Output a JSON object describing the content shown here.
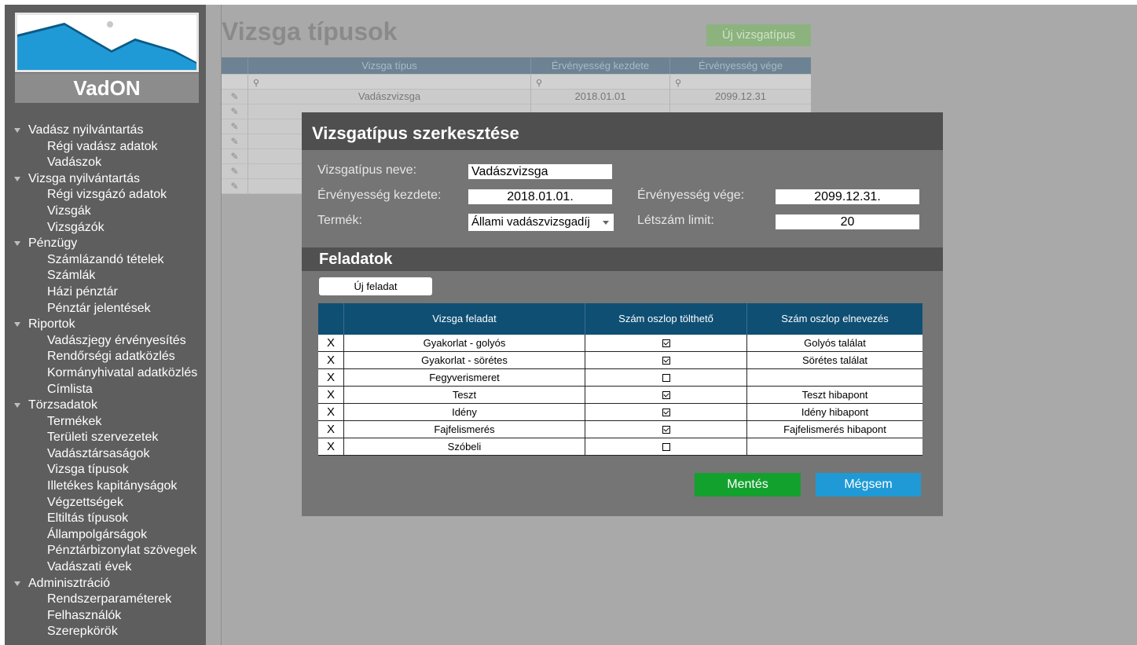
{
  "brand": "VadON",
  "menu": [
    {
      "title": "Vadász nyilvántartás",
      "items": [
        "Régi vadász adatok",
        "Vadászok"
      ]
    },
    {
      "title": "Vizsga nyilvántartás",
      "items": [
        "Régi vizsgázó adatok",
        "Vizsgák",
        "Vizsgázók"
      ]
    },
    {
      "title": "Pénzügy",
      "items": [
        "Számlázandó tételek",
        "Számlák",
        "Házi pénztár",
        "Pénztár jelentések"
      ]
    },
    {
      "title": "Riportok",
      "items": [
        "Vadászjegy érvényesítés",
        "Rendőrségi adatközlés",
        "Kormányhivatal adatközlés",
        "Címlista"
      ]
    },
    {
      "title": "Törzsadatok",
      "items": [
        "Termékek",
        "Területi szervezetek",
        "Vadásztársaságok",
        "Vizsga típusok",
        "Illetékes kapitányságok",
        "Végzettségek",
        "Eltiltás típusok",
        "Állampolgárságok",
        "Pénztárbizonylat szövegek",
        "Vadászati évek"
      ]
    },
    {
      "title": "Adminisztráció",
      "items": [
        "Rendszerparaméterek",
        "Felhasználók",
        "Szerepkörök"
      ]
    }
  ],
  "page": {
    "title": "Vizsga típusok",
    "new_button": "Új vizsgatípus",
    "table": {
      "columns": [
        "Vizsga típus",
        "Érvényesség kezdete",
        "Érvényesség vége"
      ],
      "rows": [
        [
          "Vadászvizsga",
          "2018.01.01",
          "2099.12.31"
        ]
      ]
    }
  },
  "modal": {
    "title": "Vizsgatípus szerkesztése",
    "name_label": "Vizsgatípus neve:",
    "name_value": "Vadászvizsga",
    "start_label": "Érvényesség kezdete:",
    "start_value": "2018.01.01.",
    "end_label": "Érvényesség vége:",
    "end_value": "2099.12.31.",
    "product_label": "Termék:",
    "product_value": "Állami vadászvizsgadíj",
    "limit_label": "Létszám limit:",
    "limit_value": "20",
    "tasks_title": "Feladatok",
    "new_task_button": "Új feladat",
    "tasks_columns": [
      "Vizsga feladat",
      "Szám oszlop tölthető",
      "Szám oszlop elnevezés"
    ],
    "tasks": [
      {
        "delete": "X",
        "name": "Gyakorlat - golyós",
        "numeric": true,
        "column_name": "Golyós találat"
      },
      {
        "delete": "X",
        "name": "Gyakorlat - sörétes",
        "numeric": true,
        "column_name": "Sörétes találat"
      },
      {
        "delete": "X",
        "name": "Fegyverismeret",
        "numeric": false,
        "column_name": ""
      },
      {
        "delete": "X",
        "name": "Teszt",
        "numeric": true,
        "column_name": "Teszt hibapont"
      },
      {
        "delete": "X",
        "name": "Idény",
        "numeric": true,
        "column_name": "Idény hibapont"
      },
      {
        "delete": "X",
        "name": "Fajfelismerés",
        "numeric": true,
        "column_name": "Fajfelismerés hibapont"
      },
      {
        "delete": "X",
        "name": "Szóbeli",
        "numeric": false,
        "column_name": ""
      }
    ],
    "save_button": "Mentés",
    "cancel_button": "Mégsem"
  },
  "colors": {
    "sidebar_bg": "#5e5e5e",
    "table_header": "#0f4f74",
    "save": "#13a12e",
    "cancel": "#1f9ad6",
    "new_type_button": "#8cb37e"
  },
  "icons": {
    "filter": "key-icon",
    "edit": "pencil-icon",
    "collapse": "triangle-down-icon",
    "select": "chevron-down-icon"
  }
}
